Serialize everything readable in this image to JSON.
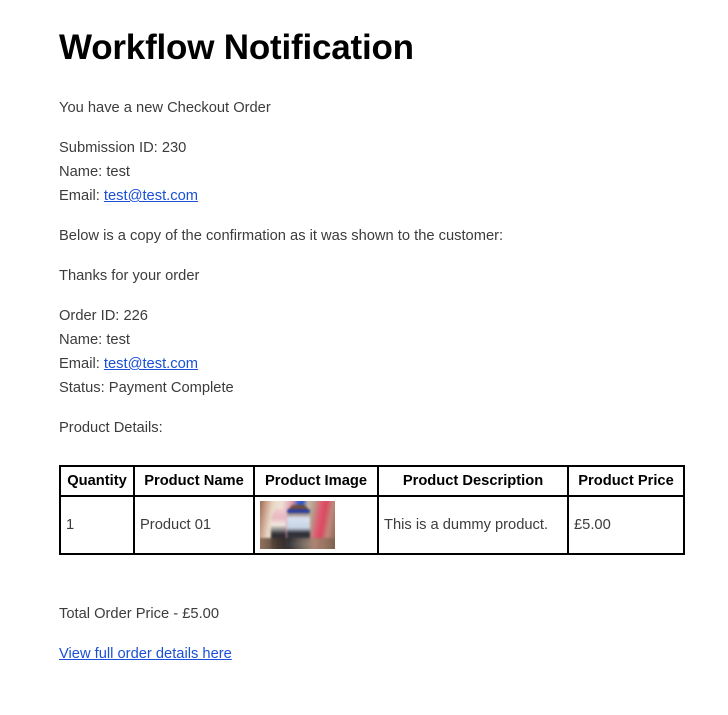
{
  "title": "Workflow Notification",
  "intro": "You have a new Checkout Order",
  "submission": {
    "id_line": "Submission ID: 230",
    "name_line": "Name: test",
    "email_label": "Email: ",
    "email_value": "test@test.com"
  },
  "copy_notice": "Below is a copy of the confirmation as it was shown to the customer:",
  "thanks": "Thanks for your order",
  "order": {
    "id_line": "Order ID: 226",
    "name_line": "Name: test",
    "email_label": "Email: ",
    "email_value": "test@test.com",
    "status_line": "Status: Payment Complete"
  },
  "product_details_label": "Product Details:",
  "table": {
    "headers": [
      "Quantity",
      "Product Name",
      "Product Image",
      "Product Description",
      "Product Price"
    ],
    "rows": [
      {
        "quantity": "1",
        "name": "Product 01",
        "image": "product-photo",
        "description": "This is a dummy product.",
        "price": "£5.00"
      }
    ]
  },
  "total_order_price": "Total Order Price - £5.00",
  "footer_link": "View full order details here",
  "colors": {
    "link": "#1a4fd6",
    "text": "#3c3c3c",
    "heading": "#000000",
    "table_border": "#000000",
    "background": "#ffffff"
  }
}
